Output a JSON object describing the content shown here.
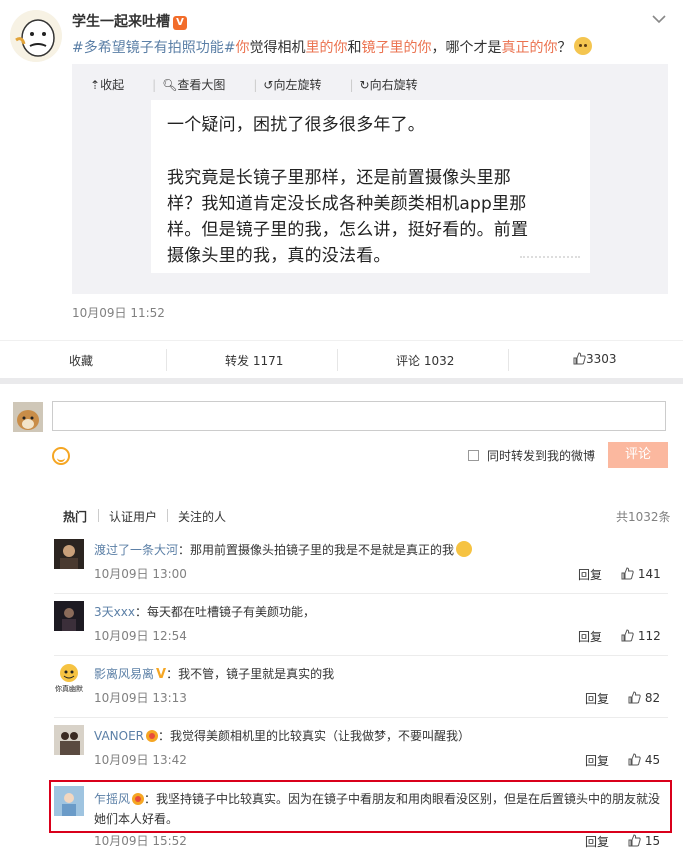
{
  "post": {
    "author": "学生一起来吐槽",
    "badge": "V",
    "hashtag1": "#多希望镜子有拍照功能#",
    "text_parts": [
      "你",
      "觉得相机",
      "里的你",
      "和",
      "镜子里的你",
      "，哪个才是",
      "真正",
      "的你",
      "？"
    ],
    "time": "10月09日 11:52"
  },
  "toolbar": {
    "collapse": "收起",
    "view_large": "查看大图",
    "rotate_left": "向左旋转",
    "rotate_right": "向右旋转"
  },
  "image_text": {
    "line1": "一个疑问，困扰了很多很多年了。",
    "line2": "我究竟是长镜子里那样，还是前置摄像头里那",
    "line3": "样？我知道肯定没长成各种美颜类相机app里那",
    "line4": "样。但是镜子里的我，怎么讲，挺好看的。前置",
    "line5": "摄像头里的我，真的没法看。"
  },
  "actions": {
    "favorite": "收藏",
    "repost": "转发 1171",
    "comment": "评论 1032",
    "like": "3303"
  },
  "composer": {
    "repost_also": "同时转发到我的微博",
    "submit": "评论"
  },
  "filters": {
    "hot": "热门",
    "verified": "认证用户",
    "following": "关注的人",
    "total": "共1032条"
  },
  "comments": [
    {
      "user": "渡过了一条大河",
      "text": "：那用前置摄像头拍镜子里的我是不是就是真正的我",
      "time": "10月09日 13:00",
      "reply": "回复",
      "likes": "141"
    },
    {
      "user": "3天xxx",
      "text": "：每天都在吐槽镜子有美颜功能，",
      "time": "10月09日 12:54",
      "reply": "回复",
      "likes": "112"
    },
    {
      "user": "影离风易离",
      "text": "：我不管，镜子里就是真实的我",
      "time": "10月09日 13:13",
      "reply": "回复",
      "likes": "82",
      "avatar_caption": "你真幽默"
    },
    {
      "user": "VANOER",
      "text": "：我觉得美颜相机里的比较真实（让我做梦，不要叫醒我）",
      "time": "10月09日 13:42",
      "reply": "回复",
      "likes": "45"
    },
    {
      "user": "乍摇风",
      "text": "：我坚持镜子中比较真实。因为在镜子中看朋友和用肉眼看没区别，但是在后置镜头中的朋友就没",
      "text2": "她们本人好看。",
      "time": "10月09日 15:52",
      "reply": "回复",
      "likes": "15"
    }
  ],
  "colors": {
    "accent": "#eb7350",
    "link_blue": "#5b7fa6",
    "highlight_border": "#d9001b",
    "submit_bg": "#fbb89f"
  }
}
